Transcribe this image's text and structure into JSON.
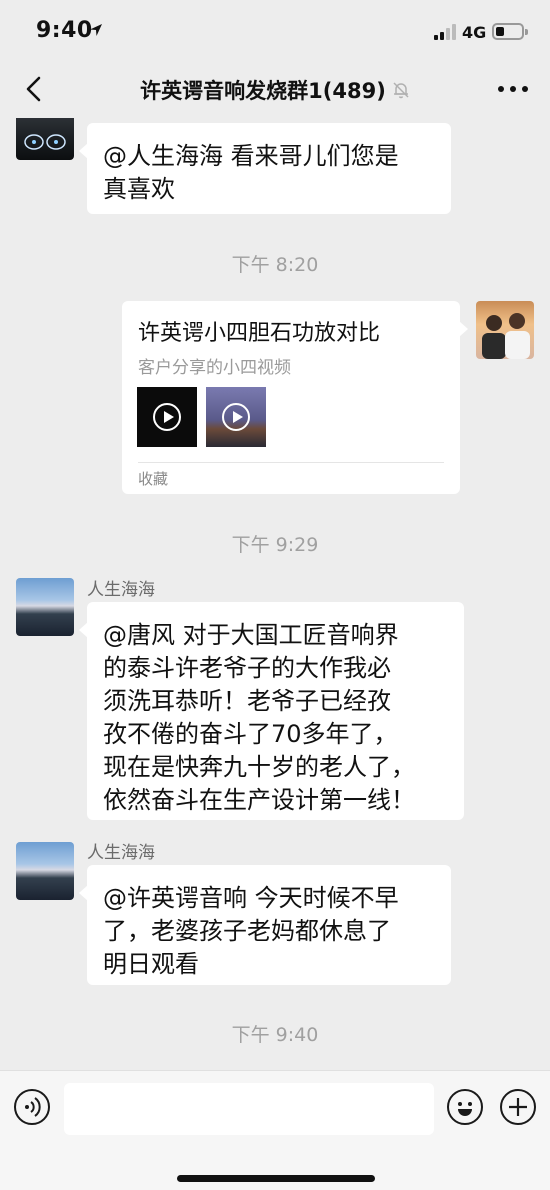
{
  "status_bar": {
    "time": "9:40",
    "network": "4G",
    "battery_level": 0.25,
    "icons": [
      "location-arrow-icon",
      "signal-icon",
      "battery-icon"
    ]
  },
  "nav": {
    "title": "许英谔音响发烧群1(489)",
    "icons": [
      "back-icon",
      "mute-icon",
      "more-icon"
    ]
  },
  "messages": [
    {
      "type": "text",
      "direction": "incoming",
      "avatar": "car-dashboard-avatar",
      "text_lines": [
        "@人生海海 看来哥儿们您是",
        "真喜欢"
      ]
    },
    {
      "type": "time",
      "text": "下午 8:20"
    },
    {
      "type": "favorite_card",
      "direction": "outgoing",
      "avatar": "two-people-avatar",
      "title": "许英谔小四胆石功放对比",
      "subtitle": "客户分享的小四视频",
      "footer": "收藏",
      "thumbnails": [
        "video-thumbnail-dark",
        "video-thumbnail-stage"
      ]
    },
    {
      "type": "time",
      "text": "下午 9:29"
    },
    {
      "type": "text",
      "direction": "incoming",
      "sender": "人生海海",
      "avatar": "sea-sunset-avatar",
      "text_lines": [
        "@唐风 对于大国工匠音响界",
        "的泰斗许老爷子的大作我必",
        "须洗耳恭听！老爷子已经孜",
        "孜不倦的奋斗了70多年了，",
        "现在是快奔九十岁的老人了，",
        "依然奋斗在生产设计第一线！"
      ]
    },
    {
      "type": "text",
      "direction": "incoming",
      "sender": "人生海海",
      "avatar": "sea-sunset-avatar",
      "text_lines": [
        "@许英谔音响 今天时候不早",
        "了，老婆孩子老妈都休息了",
        "明日观看"
      ]
    },
    {
      "type": "time",
      "text": "下午 9:40"
    }
  ],
  "input_bar": {
    "value": "",
    "icons": [
      "voice-icon",
      "emoji-icon",
      "plus-icon"
    ]
  },
  "colors": {
    "background": "#ededed",
    "bubble": "#ffffff",
    "secondary_text": "#a0a0a0"
  }
}
